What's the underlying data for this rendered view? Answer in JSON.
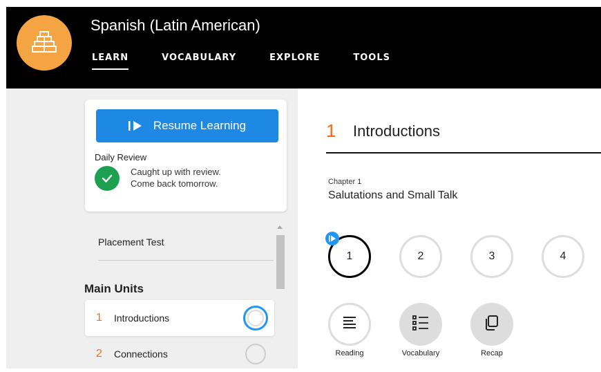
{
  "header": {
    "course_title": "Spanish (Latin American)",
    "logo_icon": "pyramid-icon",
    "tabs": [
      {
        "label": "LEARN",
        "active": true
      },
      {
        "label": "VOCABULARY",
        "active": false
      },
      {
        "label": "EXPLORE",
        "active": false
      },
      {
        "label": "TOOLS",
        "active": false
      }
    ]
  },
  "sidebar": {
    "resume_label": "Resume Learning",
    "daily_review_label": "Daily Review",
    "review_status_line1": "Caught up with review.",
    "review_status_line2": "Come back tomorrow.",
    "placement_test": "Placement Test",
    "section_title": "Main Units",
    "units": [
      {
        "number": "1",
        "label": "Introductions",
        "active": true
      },
      {
        "number": "2",
        "label": "Connections",
        "active": false
      }
    ]
  },
  "main": {
    "unit_number": "1",
    "unit_title": "Introductions",
    "chapter_label": "Chapter 1",
    "chapter_title": "Salutations and Small Talk",
    "lessons": [
      "1",
      "2",
      "3",
      "4"
    ],
    "activities": [
      {
        "label": "Reading",
        "icon": "reading-icon"
      },
      {
        "label": "Vocabulary",
        "icon": "vocabulary-list-icon"
      },
      {
        "label": "Recap",
        "icon": "recap-icon"
      }
    ]
  },
  "colors": {
    "accent_orange": "#ef6c1a",
    "primary_blue": "#1e88e5",
    "success_green": "#1da150",
    "logo_orange": "#f5a443"
  }
}
